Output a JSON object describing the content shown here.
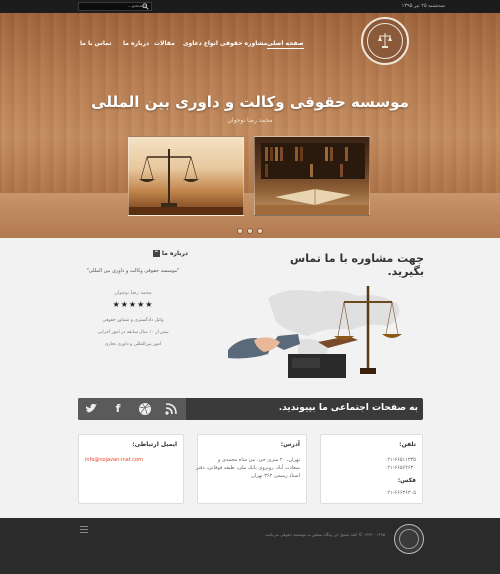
{
  "topbar": {
    "search_placeholder": "جستجو...",
    "date": "سه‌شنبه ۲۵ تیر ۱۳۹۵"
  },
  "nav": {
    "items": [
      {
        "label": "صفحه اصلی"
      },
      {
        "label": "مشاوره حقوقی"
      },
      {
        "label": "انواع دعاوی"
      },
      {
        "label": "مقالات"
      },
      {
        "label": "درباره ما"
      },
      {
        "label": "تماس با ما"
      }
    ]
  },
  "hero": {
    "title": "موسسه حقوقی وکالت و داوری بین المللی",
    "subtitle": "محمد رضا نوجوان"
  },
  "consult": {
    "title": "جهت مشاوره با ما تماس بگیرید."
  },
  "about": {
    "heading": "درباره ما",
    "quote": "\"موسسه حقوقی وکالت و داوری بین المللی\"",
    "name": "محمد رضا نوجوان",
    "stars": "★★★★★",
    "lines": [
      "وکیل دادگستری و مشاور حقوقی",
      "بیش از ۱۰ سال سابقه در امور اجرایی",
      "امور بین‌المللی و داوری تجاری"
    ]
  },
  "social": {
    "text": "به صفحات اجتماعی ما بپیوندید.",
    "icons": [
      "rss-icon",
      "dribbble-icon",
      "facebook-icon",
      "twitter-icon"
    ]
  },
  "contact": {
    "phone_title": "تلفن:",
    "phones": [
      "۰۲۱-۶۶۵۱۱۳۳۵",
      "۰۲۱-۶۶۵۶۴۶۳۰"
    ],
    "fax_title": "فکس:",
    "fax": "۰۲۱-۶۶۶۳۶۳۰۵",
    "address_title": "آدرس:",
    "address_lines": [
      "تهران، ۲۰ متری جی، بین شاه محمدی و",
      "سعادت آباد، روبروی بانک ملی، طبقه فوقانی، دفتر",
      "اسناد رسمی ۳۶۲ تهران"
    ],
    "email_title": "ایمیل ارتباطی:",
    "email": "info@nojavan-inat.com"
  },
  "footer": {
    "copyright": "۱۳۹۵ - ۱۳۹۳ © کلیه حقوق این وبگاه متعلق به موسسه حقوقی می‌باشد."
  },
  "colors": {
    "accent": "#e2442a",
    "dark": "#3a3a3a",
    "footer": "#2b2b2b"
  }
}
